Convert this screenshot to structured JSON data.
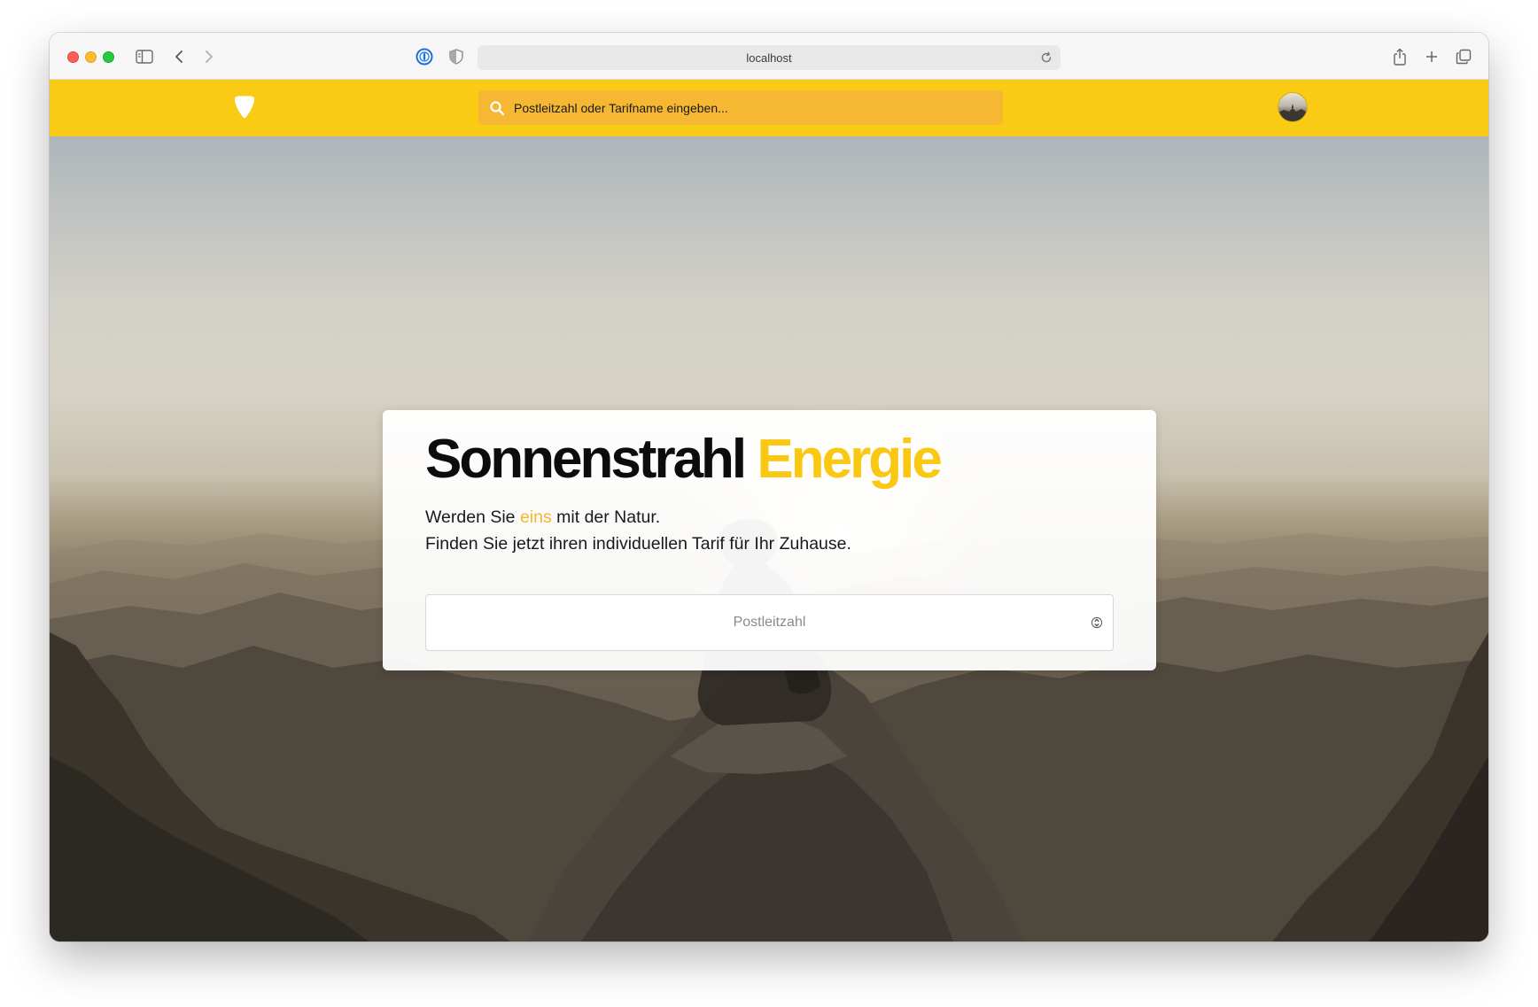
{
  "browser": {
    "url": "localhost"
  },
  "header": {
    "search_placeholder": "Postleitzahl oder Tarifname eingeben..."
  },
  "hero": {
    "title_part1": "Sonnenstrahl",
    "title_part2": "Energie",
    "line1_before": "Werden Sie ",
    "line1_accent": "eins",
    "line1_after": " mit der Natur.",
    "line2": "Finden Sie jetzt ihren individuellen Tarif für Ihr Zuhause.",
    "zip_placeholder": "Postleitzahl"
  },
  "colors": {
    "brand_yellow": "#f9cb14",
    "search_bg": "#f6b832",
    "accent_text": "#f6b72a"
  }
}
